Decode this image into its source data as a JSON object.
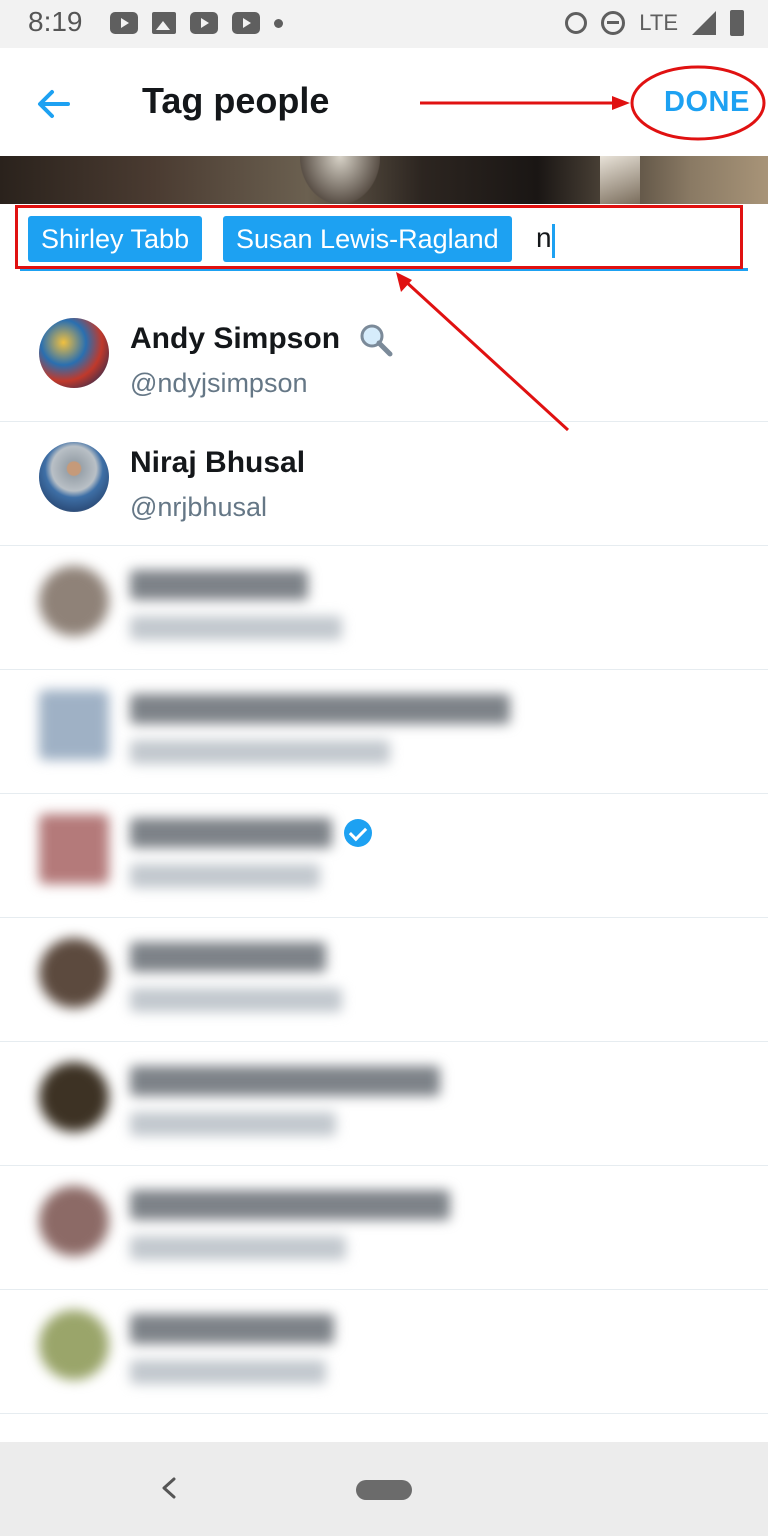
{
  "status_bar": {
    "time": "8:19",
    "network": "LTE",
    "left_icons": [
      "youtube-icon",
      "image-icon",
      "youtube-icon",
      "youtube-icon",
      "dot-icon"
    ],
    "right_icons": [
      "alarm-icon",
      "do-not-disturb-icon",
      "signal-icon",
      "battery-icon"
    ]
  },
  "header": {
    "back_icon": "arrow-left-icon",
    "title": "Tag people",
    "done_label": "DONE"
  },
  "tag_input": {
    "chips": [
      "Shirley Tabb",
      "Susan Lewis-Ragland"
    ],
    "typed_value": "n"
  },
  "users": [
    {
      "name": "Andy Simpson",
      "handle": "@ndyjsimpson",
      "badge": "search-icon",
      "blurred": false
    },
    {
      "name": "Niraj Bhusal",
      "handle": "@nrjbhusal",
      "blurred": false
    },
    {
      "blurred": true
    },
    {
      "blurred": true
    },
    {
      "blurred": true,
      "badge": "verified-icon"
    },
    {
      "blurred": true
    },
    {
      "blurred": true
    },
    {
      "blurred": true
    },
    {
      "blurred": true
    }
  ],
  "nav_bar": {
    "icons": [
      "nav-back-icon",
      "home-pill-icon"
    ]
  },
  "colors": {
    "accent": "#1da1f2",
    "annotation": "#e01111",
    "text_primary": "#14171a",
    "text_secondary": "#657786"
  }
}
